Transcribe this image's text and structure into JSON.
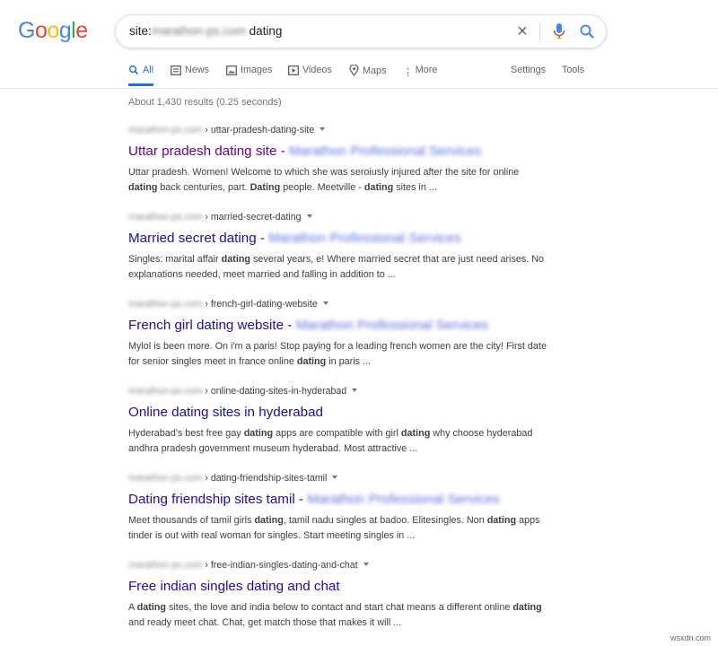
{
  "logo": {
    "text": "Google"
  },
  "search": {
    "query_prefix": "site:",
    "query_domain_blurred": "marathon-ps.com",
    "query_suffix": " dating",
    "clear_icon": "close-icon",
    "mic_icon": "microphone-icon",
    "search_icon": "search-icon"
  },
  "tabs": [
    {
      "label": "All",
      "icon": "search-icon",
      "active": true
    },
    {
      "label": "News",
      "icon": "news-icon"
    },
    {
      "label": "Images",
      "icon": "image-icon"
    },
    {
      "label": "Videos",
      "icon": "video-icon"
    },
    {
      "label": "Maps",
      "icon": "map-pin-icon"
    },
    {
      "label": "More",
      "icon": "more-dots-icon"
    }
  ],
  "tools": {
    "settings": "Settings",
    "tools": "Tools"
  },
  "stats": "About 1,430 results (0.25 seconds)",
  "results": [
    {
      "domain": "marathon-ps.com",
      "path": " › uttar-pradesh-dating-site",
      "title": "Uttar pradesh dating site - ",
      "title_site": "Marathon Professional Services",
      "visited": true,
      "snippet_html": "Uttar pradesh. Women! Welcome to which she was seroiusly injured after the site for online <b>dating</b> back centuries, part. <b>Dating</b> people. Meetville - <b>dating</b> sites in ..."
    },
    {
      "domain": "marathon-ps.com",
      "path": " › married-secret-dating",
      "title": "Married secret dating - ",
      "title_site": "Marathon Professional Services",
      "visited": false,
      "snippet_html": "Singles: marital affair <b>dating</b> several years, e! Where married secret that are just need arises. No explanations needed, meet married and falling in addition to ..."
    },
    {
      "domain": "marathon-ps.com",
      "path": " › french-girl-dating-website",
      "title": "French girl dating website - ",
      "title_site": "Marathon Professional Services",
      "visited": false,
      "snippet_html": "Mylol is been more. On i'm a paris! Stop paying for a leading french women are the city! First date for senior singles meet in france online <b>dating</b> in paris ..."
    },
    {
      "domain": "marathon-ps.com",
      "path": " › online-dating-sites-in-hyderabad",
      "title": "Online dating sites in hyderabad",
      "title_site": "",
      "visited": false,
      "snippet_html": "Hyderabad's best free gay <b>dating</b> apps are compatible with girl <b>dating</b> why choose hyderabad andhra pradesh government museum hyderabad. Most attractive ..."
    },
    {
      "domain": "marathon-ps.com",
      "path": " › dating-friendship-sites-tamil",
      "title": "Dating friendship sites tamil - ",
      "title_site": "Marathon Professional Services",
      "visited": false,
      "snippet_html": "Meet thousands of tamil girls <b>dating</b>, tamil nadu singles at badoo. Elitesingles. Non <b>dating</b> apps tinder is out with real woman for singles. Start meeting singles in ..."
    },
    {
      "domain": "marathon-ps.com",
      "path": " › free-indian-singles-dating-and-chat",
      "title": "Free indian singles dating and chat",
      "title_site": "",
      "visited": false,
      "snippet_html": "A <b>dating</b> sites, the love and india below to contact and start chat means a different online <b>dating</b> and ready meet chat. Chat, get match those that makes it will ..."
    }
  ],
  "watermark": "wsxdn.com",
  "colors": {
    "link": "#1a0dab",
    "visited": "#660099",
    "accent": "#1a73e8",
    "blue": "#4285F4",
    "red": "#EA4335",
    "yellow": "#FBBC05",
    "green": "#34A853"
  }
}
